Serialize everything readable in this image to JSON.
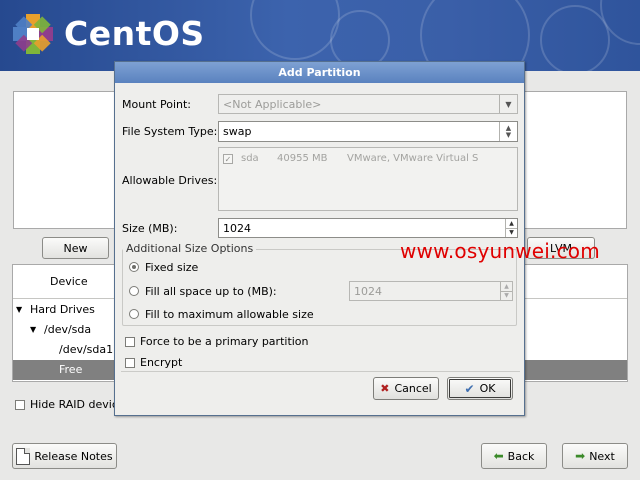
{
  "banner": {
    "logo_text": "CentOS",
    "colors": {
      "banner_blue": "#3c63ad",
      "logo_orange": "#e8a02c",
      "logo_purple": "#8e3e8d",
      "logo_green": "#7fb53a",
      "logo_blue": "#4f7fc5"
    }
  },
  "main": {
    "new_button": "New",
    "lvm_button": "LVM",
    "device_tree": {
      "column_header": "Device",
      "rows": [
        {
          "label": "Hard Drives"
        },
        {
          "label": "/dev/sda"
        },
        {
          "label": "/dev/sda1"
        },
        {
          "label": "Free"
        }
      ]
    },
    "hide_raid_label": "Hide RAID device",
    "release_notes_button": "Release Notes",
    "back_button": "Back",
    "next_button": "Next"
  },
  "dialog": {
    "title": "Add Partition",
    "mount_point_label": "Mount Point:",
    "mount_point_value": "<Not Applicable>",
    "fs_type_label": "File System Type:",
    "fs_type_value": "swap",
    "allowable_drives_label": "Allowable Drives:",
    "drives": [
      {
        "name": "sda",
        "size": "40955 MB",
        "model": "VMware, VMware Virtual S",
        "checked": true
      }
    ],
    "size_label": "Size (MB):",
    "size_value": "1024",
    "additional_options_label": "Additional Size Options",
    "opt_fixed": "Fixed size",
    "opt_fill_up_to": "Fill all space up to (MB):",
    "fill_up_to_value": "1024",
    "opt_fill_max": "Fill to maximum allowable size",
    "primary_label": "Force to be a primary partition",
    "encrypt_label": "Encrypt",
    "cancel_button": "Cancel",
    "ok_button": "OK"
  },
  "watermark": "www.osyunwei.com"
}
